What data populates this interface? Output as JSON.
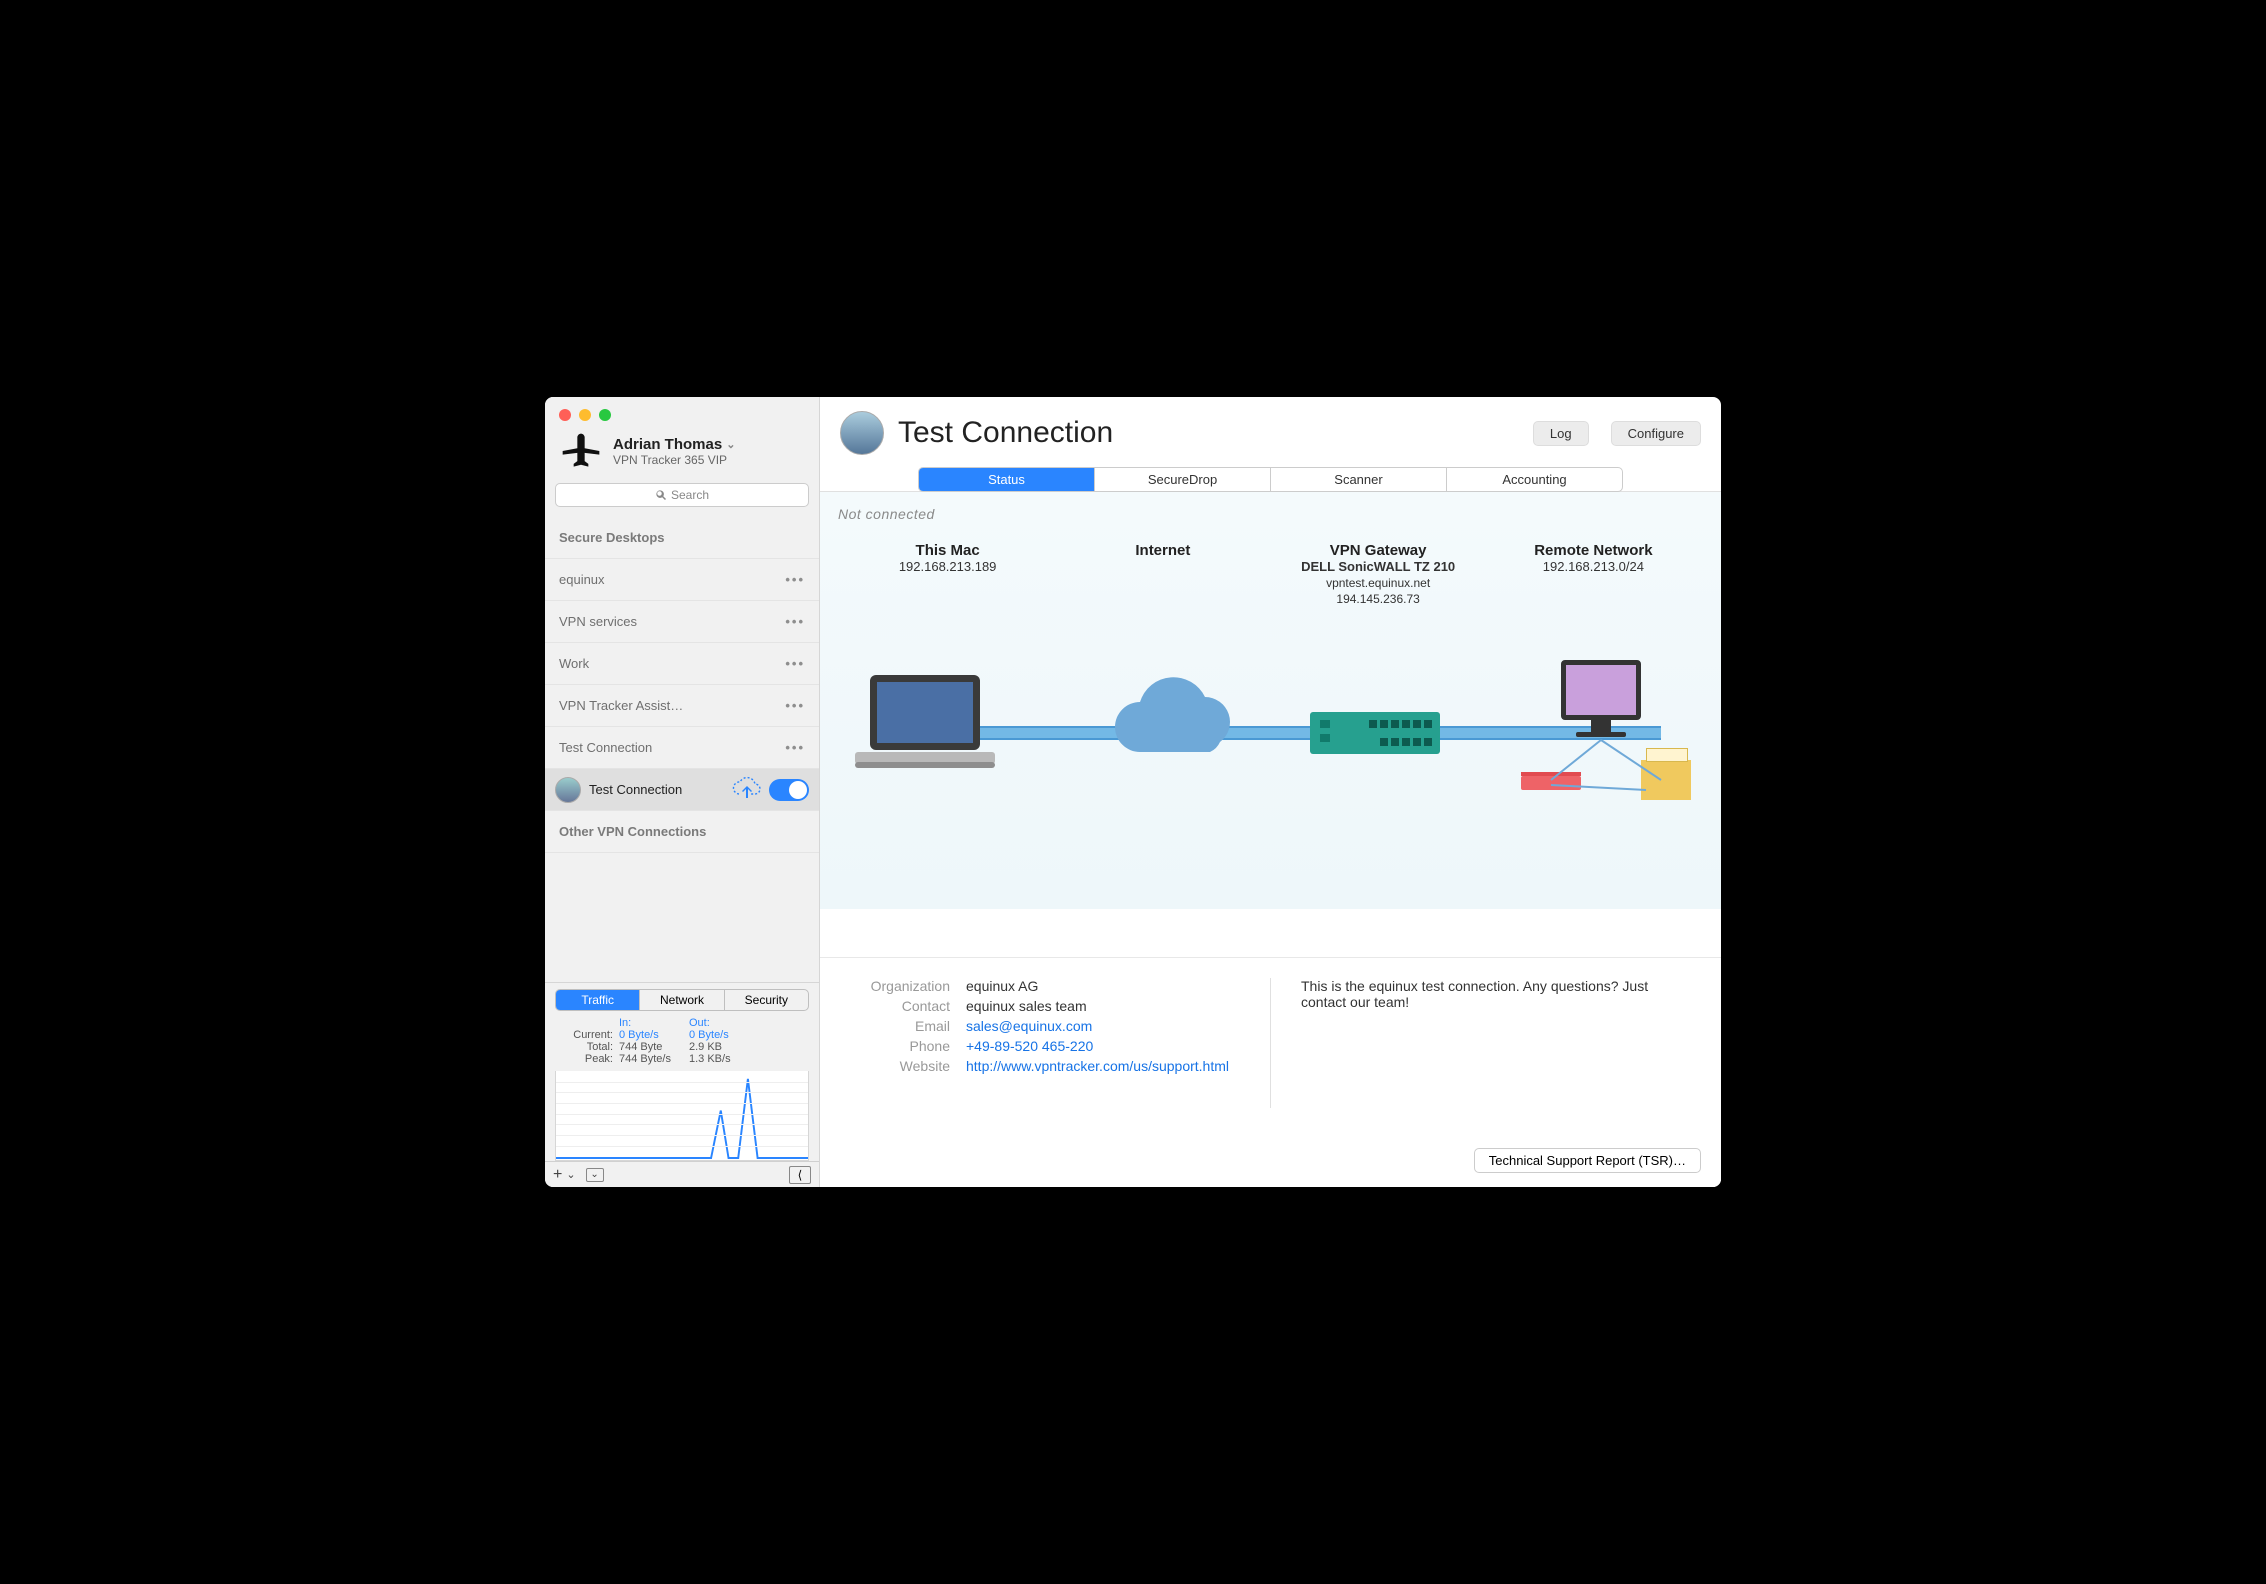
{
  "user": {
    "name": "Adrian Thomas",
    "plan": "VPN Tracker 365 VIP"
  },
  "search": {
    "placeholder": "Search"
  },
  "sidebar": {
    "sections": [
      {
        "label": "Secure Desktops",
        "dots": false
      },
      {
        "label": "equinux",
        "dots": true
      },
      {
        "label": "VPN services",
        "dots": true
      },
      {
        "label": "Work",
        "dots": true
      },
      {
        "label": "VPN Tracker Assist…",
        "dots": true
      },
      {
        "label": "Test Connection",
        "dots": true
      }
    ],
    "active_item": "Test Connection",
    "other_label": "Other VPN Connections"
  },
  "traffic_tabs": {
    "a": "Traffic",
    "b": "Network",
    "c": "Security"
  },
  "traffic": {
    "in_label": "In:",
    "out_label": "Out:",
    "rows": [
      {
        "k": "Current:",
        "in": "0 Byte/s",
        "out": "0 Byte/s",
        "blue": true
      },
      {
        "k": "Total:",
        "in": "744 Byte",
        "out": "2.9 KB",
        "blue": false
      },
      {
        "k": "Peak:",
        "in": "744 Byte/s",
        "out": "1.3 KB/s",
        "blue": false
      }
    ]
  },
  "header": {
    "title": "Test Connection",
    "log": "Log",
    "configure": "Configure"
  },
  "tabs": {
    "a": "Status",
    "b": "SecureDrop",
    "c": "Scanner",
    "d": "Accounting"
  },
  "status_text": "Not connected",
  "nodes": {
    "mac": {
      "title": "This Mac",
      "sub": "192.168.213.189"
    },
    "inet": {
      "title": "Internet"
    },
    "gw": {
      "title": "VPN Gateway",
      "sub": "DELL SonicWALL TZ 210",
      "host": "vpntest.equinux.net",
      "ip": "194.145.236.73"
    },
    "rn": {
      "title": "Remote Network",
      "sub": "192.168.213.0/24"
    }
  },
  "info": {
    "org_k": "Organization",
    "org_v": "equinux AG",
    "contact_k": "Contact",
    "contact_v": "equinux sales team",
    "email_k": "Email",
    "email_v": "sales@equinux.com",
    "phone_k": "Phone",
    "phone_v": "+49-89-520 465-220",
    "web_k": "Website",
    "web_v": "http://www.vpntracker.com/us/support.html"
  },
  "note": "This is the equinux test connection. Any questions? Just contact our team!",
  "tsr": "Technical Support Report (TSR)…"
}
